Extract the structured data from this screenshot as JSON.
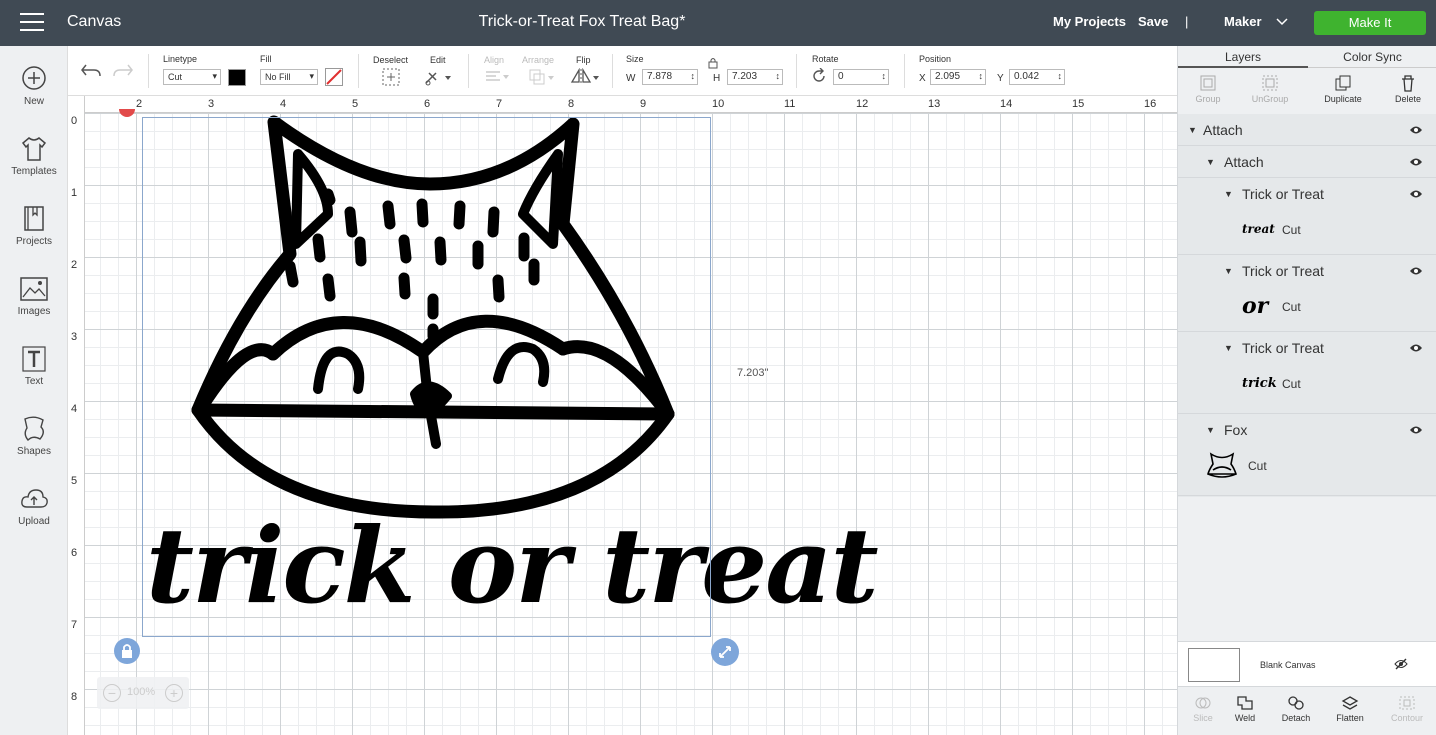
{
  "header": {
    "app_title": "Canvas",
    "doc_title": "Trick-or-Treat Fox Treat Bag*",
    "my_projects": "My Projects",
    "save": "Save",
    "separator": "|",
    "machine": "Maker",
    "make_it": "Make It"
  },
  "sidebar": {
    "items": [
      {
        "label": "New",
        "icon": "plus-circle-icon"
      },
      {
        "label": "Templates",
        "icon": "tshirt-icon"
      },
      {
        "label": "Projects",
        "icon": "book-icon"
      },
      {
        "label": "Images",
        "icon": "image-icon"
      },
      {
        "label": "Text",
        "icon": "text-icon"
      },
      {
        "label": "Shapes",
        "icon": "shapes-icon"
      },
      {
        "label": "Upload",
        "icon": "cloud-upload-icon"
      }
    ]
  },
  "toolbar": {
    "linetype_label": "Linetype",
    "linetype_value": "Cut",
    "fill_label": "Fill",
    "fill_value": "No Fill",
    "deselect_label": "Deselect",
    "edit_label": "Edit",
    "align_label": "Align",
    "arrange_label": "Arrange",
    "flip_label": "Flip",
    "size_label": "Size",
    "w_label": "W",
    "w_value": "7.878",
    "h_label": "H",
    "h_value": "7.203",
    "rotate_label": "Rotate",
    "rotate_value": "0",
    "position_label": "Position",
    "x_label": "X",
    "x_value": "2.095",
    "y_label": "Y",
    "y_value": "0.042",
    "linetype_color": "#000000"
  },
  "canvas": {
    "ruler_top": [
      "2",
      "3",
      "4",
      "5",
      "6",
      "7",
      "8",
      "9",
      "10",
      "11",
      "12",
      "13",
      "14",
      "15",
      "16"
    ],
    "ruler_left": [
      "0",
      "1",
      "2",
      "3",
      "4",
      "5",
      "6",
      "7",
      "8"
    ],
    "height_readout": "7.203\"",
    "zoom": "100%",
    "art_text": "trick or treat"
  },
  "panel": {
    "tabs": [
      "Layers",
      "Color Sync"
    ],
    "tools": [
      {
        "label": "Group",
        "icon": "group-icon",
        "disabled": true
      },
      {
        "label": "UnGroup",
        "icon": "ungroup-icon",
        "disabled": true
      },
      {
        "label": "Duplicate",
        "icon": "duplicate-icon",
        "disabled": false
      },
      {
        "label": "Delete",
        "icon": "trash-icon",
        "disabled": false
      }
    ],
    "layers": [
      {
        "name": "Attach"
      },
      {
        "name": "Attach"
      },
      {
        "name": "Trick or Treat",
        "thumb": "treat",
        "op": "Cut"
      },
      {
        "name": "Trick or Treat",
        "thumb": "or",
        "op": "Cut"
      },
      {
        "name": "Trick or Treat",
        "thumb": "trick",
        "op": "Cut"
      },
      {
        "name": "Fox",
        "op": "Cut"
      }
    ],
    "blank_canvas": "Blank Canvas",
    "bottom_tools": [
      {
        "label": "Slice",
        "disabled": true
      },
      {
        "label": "Weld",
        "disabled": false
      },
      {
        "label": "Detach",
        "disabled": false
      },
      {
        "label": "Flatten",
        "disabled": false
      },
      {
        "label": "Contour",
        "disabled": true
      }
    ]
  }
}
